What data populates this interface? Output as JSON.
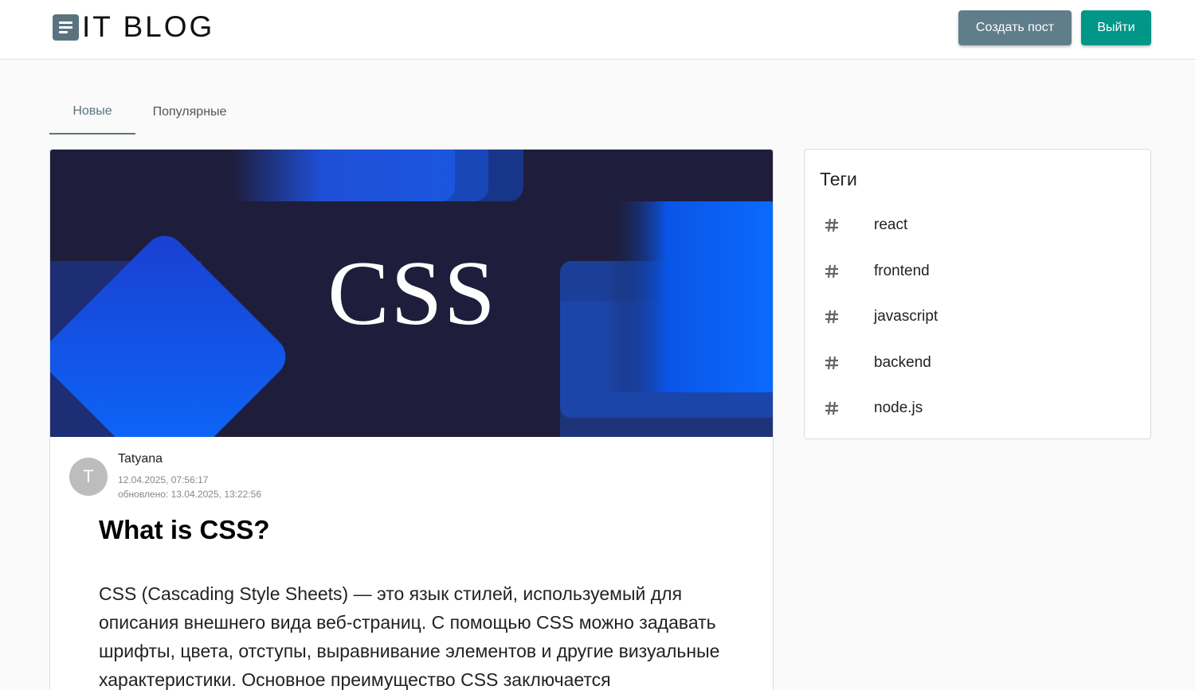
{
  "header": {
    "logo_text": "IT BLOG",
    "create_post_label": "Создать пост",
    "logout_label": "Выйти"
  },
  "tabs": [
    {
      "label": "Новые",
      "active": true
    },
    {
      "label": "Популярные",
      "active": false
    }
  ],
  "post": {
    "cover_text": "CSS",
    "author": {
      "avatar_letter": "T",
      "name": "Tatyana",
      "created": "12.04.2025, 07:56:17",
      "updated": "обновлено: 13.04.2025, 13:22:56"
    },
    "title": "What is CSS?",
    "body": "CSS (Cascading Style Sheets) — это язык стилей, используемый для описания внешнего вида веб-страниц. С помощью CSS можно задавать шрифты, цвета, отступы, выравнивание элементов и другие визуальные характеристики. Основное преимущество CSS заключается"
  },
  "tags": {
    "title": "Теги",
    "items": [
      {
        "label": "react"
      },
      {
        "label": "frontend"
      },
      {
        "label": "javascript"
      },
      {
        "label": "backend"
      },
      {
        "label": "node.js"
      }
    ]
  },
  "colors": {
    "create_button": "#607d8b",
    "logout_button": "#009688",
    "cover_background": "#1e1d3b",
    "accent": "#5b7380"
  }
}
